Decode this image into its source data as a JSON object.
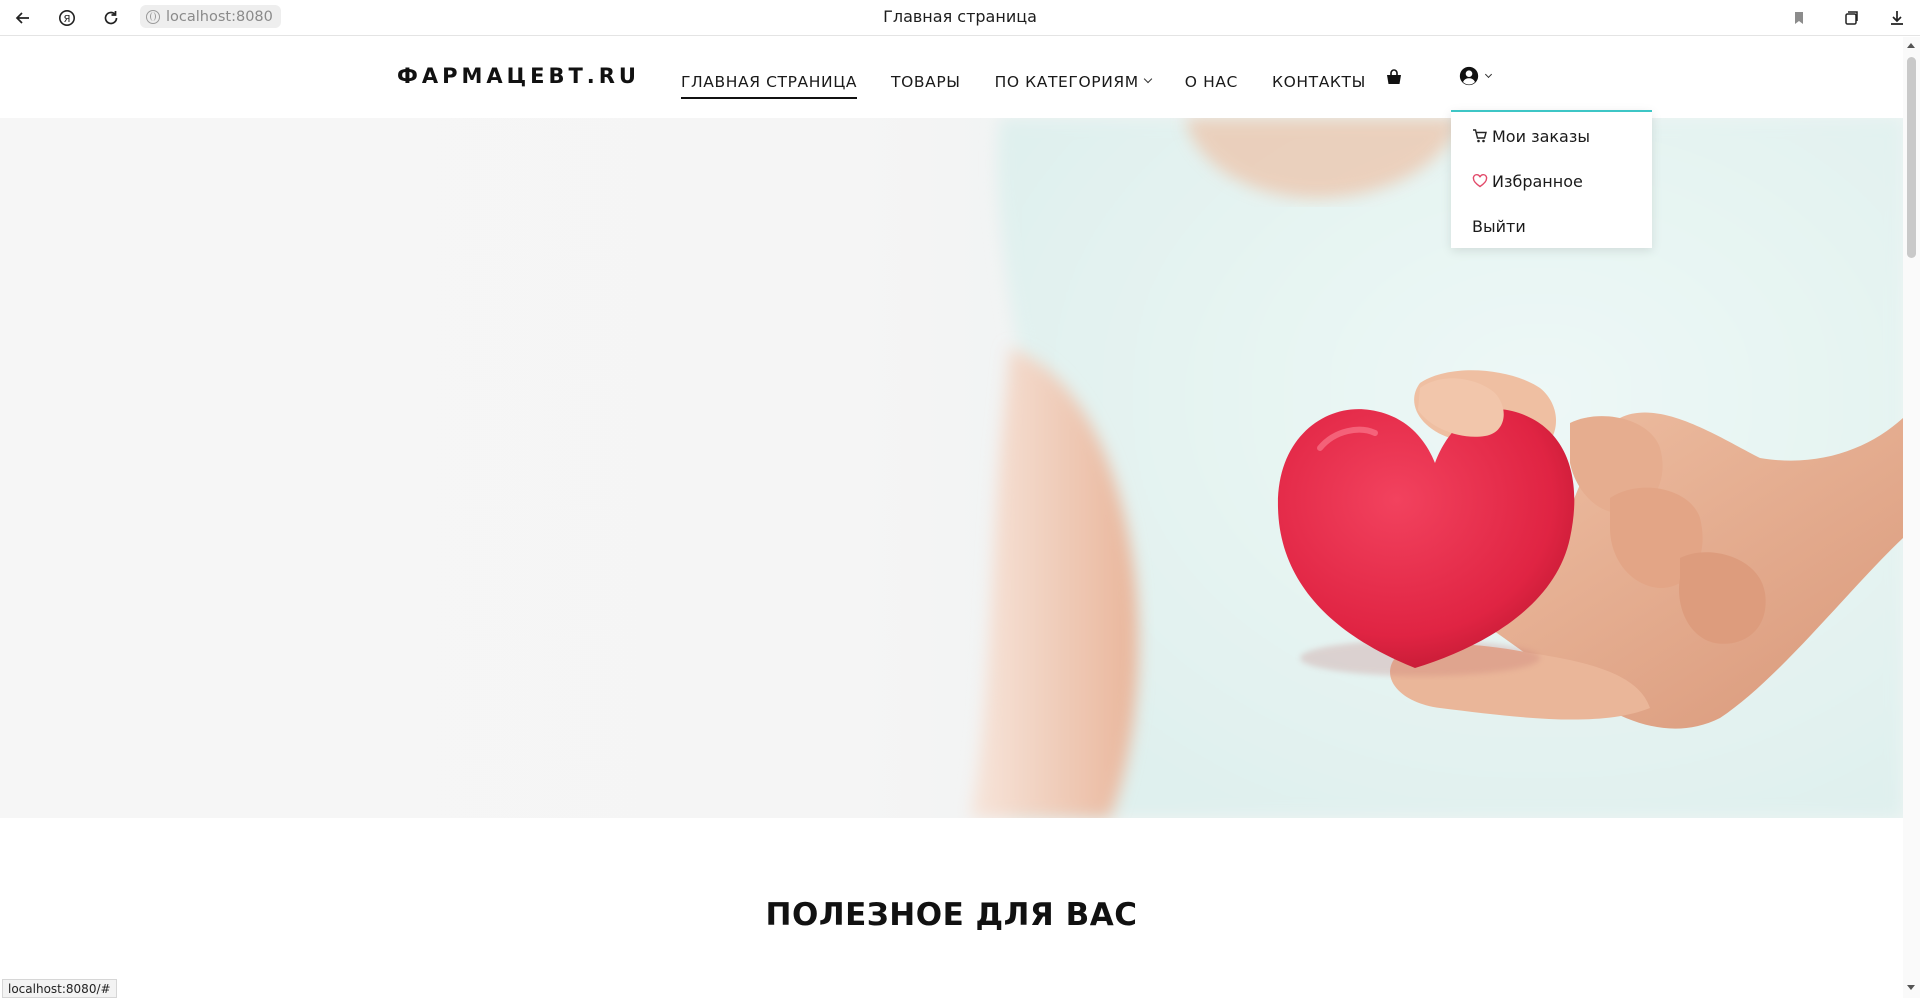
{
  "browser": {
    "url": "localhost:8080",
    "tab_title": "Главная страница",
    "status_url": "localhost:8080/#"
  },
  "header": {
    "logo": "ФАРМАЦЕВТ.RU",
    "nav": [
      {
        "label": "ГЛАВНАЯ СТРАНИЦА",
        "active": true
      },
      {
        "label": "ТОВАРЫ",
        "active": false
      },
      {
        "label": "ПО КАТЕГОРИЯМ",
        "active": false,
        "has_dropdown": true
      },
      {
        "label": "О НАС",
        "active": false
      },
      {
        "label": "КОНТАКТЫ",
        "active": false
      }
    ]
  },
  "user_menu": {
    "items": [
      {
        "label": "Мои заказы",
        "icon": "cart-icon"
      },
      {
        "label": "Избранное",
        "icon": "heart-outline-icon"
      },
      {
        "label": "Выйти"
      }
    ]
  },
  "hero": {
    "image_subject": "hand holding a red heart"
  },
  "section": {
    "title": "ПОЛЕЗНОЕ ДЛЯ ВАС"
  },
  "colors": {
    "accent": "#3ec6c6",
    "heart": "#e02443",
    "heart_icon": "#e24a6a"
  }
}
